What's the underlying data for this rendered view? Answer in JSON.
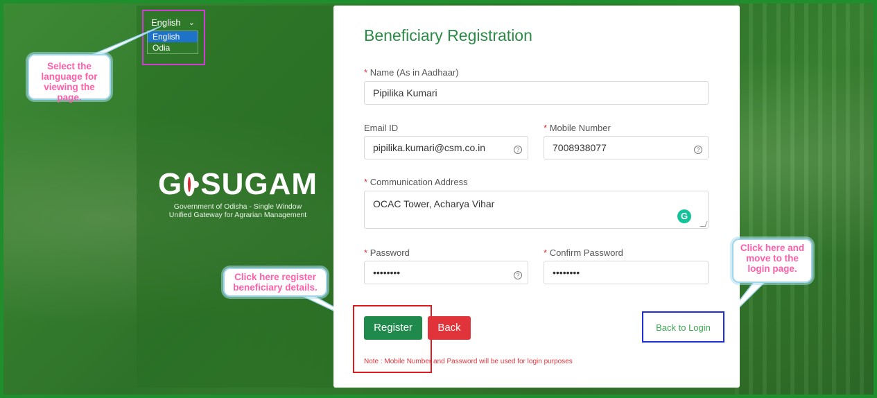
{
  "language": {
    "selected": "English",
    "options": [
      "English",
      "Odia"
    ],
    "highlighted": "English"
  },
  "brand": {
    "logo_left": "G",
    "logo_right": "SUGAM",
    "subtitle_line1": "Government of Odisha - Single Window",
    "subtitle_line2": "Unified Gateway for Agrarian Management"
  },
  "callouts": {
    "language": "Select the language for viewing the page.",
    "register": "Click here register beneficiary details.",
    "login": "Click here and move to the login page."
  },
  "form": {
    "title": "Beneficiary Registration",
    "required_mark": "*",
    "name_label": "Name (As in Aadhaar)",
    "name_value": "Pipilika Kumari",
    "email_label": "Email ID",
    "email_value": "pipilika.kumari@csm.co.in",
    "mobile_label": "Mobile Number",
    "mobile_value": "7008938077",
    "address_label": "Communication Address",
    "address_value": "OCAC Tower, Acharya Vihar",
    "password_label": "Password",
    "password_value": "••••••••",
    "confirm_label": "Confirm Password",
    "confirm_value": "••••••••",
    "help_glyph": "?",
    "register_label": "Register",
    "back_label": "Back",
    "back_to_login_label": "Back to Login",
    "note": "Note : Mobile Number and Password will be used for login purposes"
  },
  "colors": {
    "accent_green": "#2b8a46",
    "register_green": "#1f8a4c",
    "back_red": "#e0343a",
    "callout_text": "#ff5fa8"
  }
}
